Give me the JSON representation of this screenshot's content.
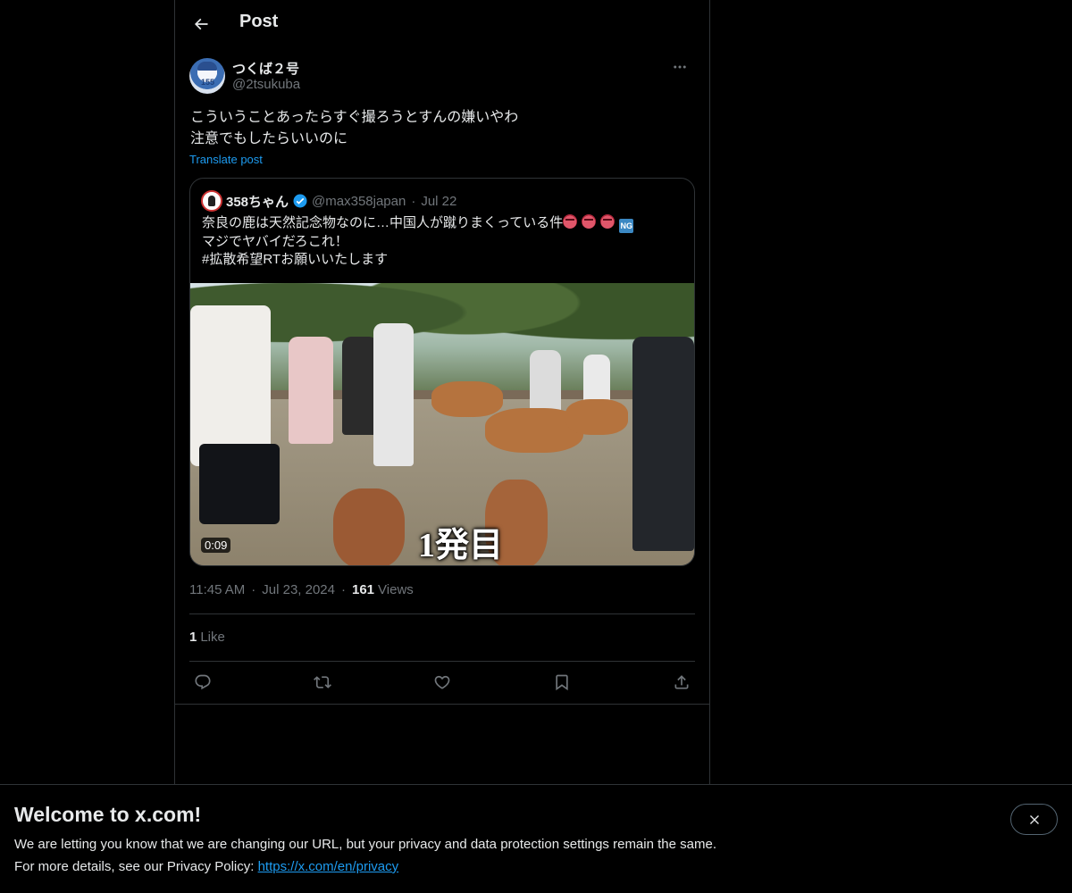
{
  "header": {
    "title": "Post"
  },
  "post": {
    "author": {
      "display_name": "つくば２号",
      "handle": "@2tsukuba",
      "avatar_number": "155"
    },
    "text_lines": [
      "こういうことあったらすぐ撮ろうとすんの嫌いやわ",
      "注意でもしたらいいのに"
    ],
    "translate_label": "Translate post",
    "quote": {
      "name": "358ちゃん",
      "handle": "@max358japan",
      "dot": "·",
      "date": "Jul 22",
      "line1": "奈良の鹿は天然記念物なのに…中国人が蹴りまくっている件",
      "emojis": [
        "angry-face-icon",
        "angry-face-icon",
        "angry-face-icon",
        "ng-button-icon"
      ],
      "ng_label": "NG",
      "line2": "マジでヤバイだろこれ！",
      "line3": "#拡散希望RTお願いいたします",
      "video": {
        "caption": "1発目",
        "duration": "0:09"
      }
    },
    "meta": {
      "time": "11:45 AM",
      "sep1": "·",
      "date": "Jul 23, 2024",
      "sep2": "·",
      "views_count": "161",
      "views_label": "Views"
    },
    "likes": {
      "count": "1",
      "label": "Like"
    },
    "actions": [
      "reply-icon",
      "repost-icon",
      "like-icon",
      "bookmark-icon",
      "share-icon"
    ]
  },
  "banner": {
    "title": "Welcome to x.com!",
    "line1": "We are letting you know that we are changing our URL, but your privacy and data protection settings remain the same.",
    "line2_prefix": "For more details, see our Privacy Policy: ",
    "link": "https://x.com/en/privacy"
  },
  "colors": {
    "background": "#000000",
    "text": "#e7e9ea",
    "secondary": "#71767b",
    "accent": "#1d9bf0",
    "border": "#2f3336"
  }
}
